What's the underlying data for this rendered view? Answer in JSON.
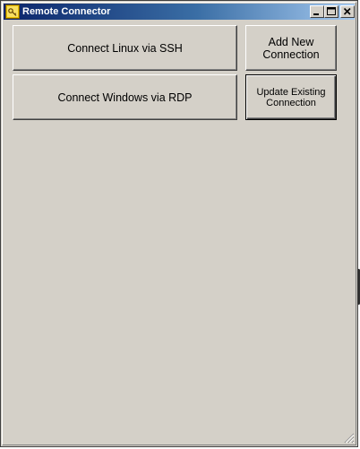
{
  "window": {
    "title": "Remote Connector",
    "title_bar_colors": [
      "#0a246a",
      "#a6caf0"
    ],
    "background": "#d4d0c8",
    "icons": {
      "app": "app-key-icon",
      "minimize": "minimize-icon",
      "maximize": "maximize-icon",
      "close": "close-icon",
      "resize": "resize-grip-icon"
    }
  },
  "buttons": {
    "ssh": "Connect Linux via SSH",
    "rdp": "Connect Windows via RDP",
    "add": "Add New Connection",
    "update": "Update Existing Connection"
  }
}
